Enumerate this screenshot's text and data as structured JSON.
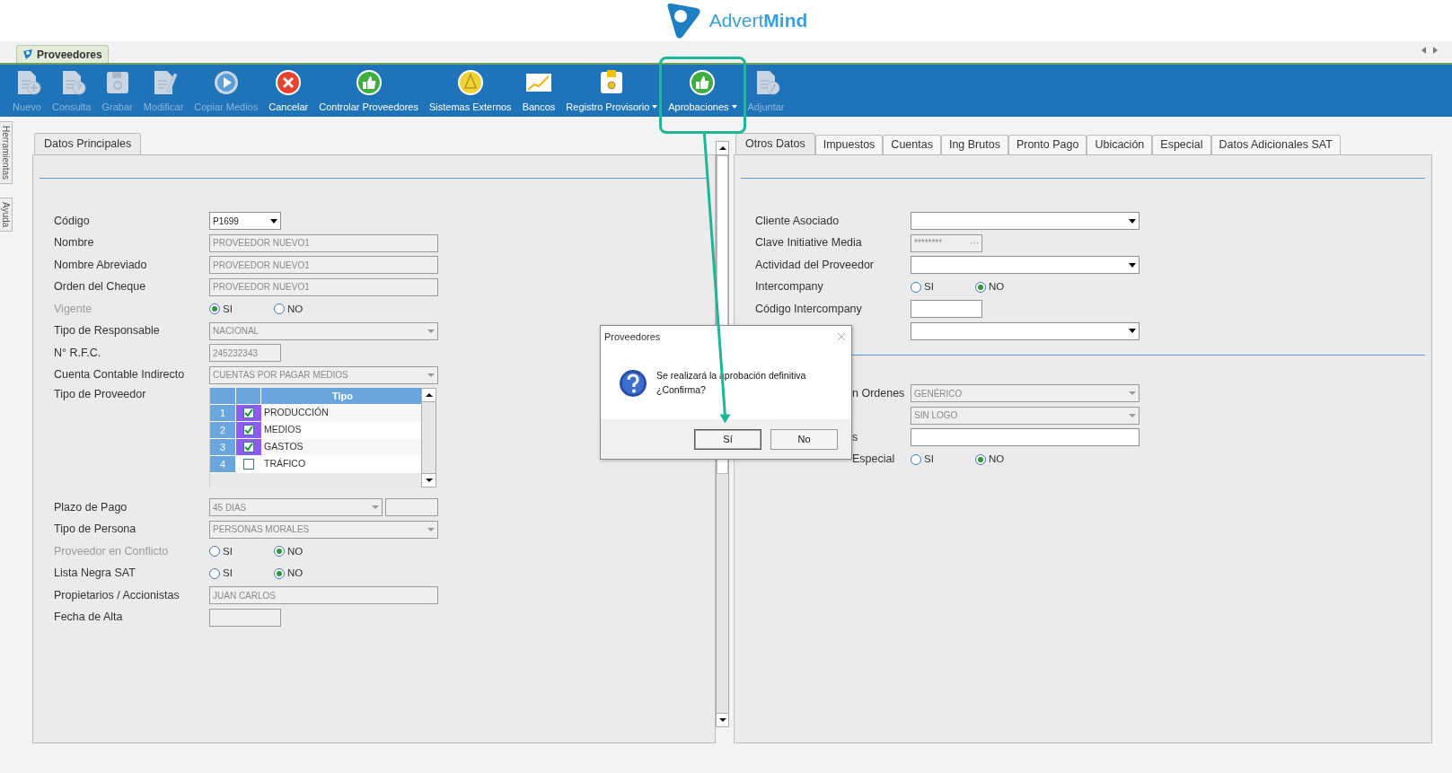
{
  "app_header": {
    "logo": "Advert**Mind**"
  },
  "document_tabs": [
    {
      "label": "Proveedores",
      "selected": true
    }
  ],
  "toolbar": [
    {
      "label": "Nuevo",
      "disabled": true,
      "dropdown": false,
      "highlighted": false
    },
    {
      "label": "Consulta",
      "disabled": true,
      "dropdown": false,
      "highlighted": false
    },
    {
      "label": "Grabar",
      "disabled": true,
      "dropdown": false,
      "highlighted": false
    },
    {
      "label": "Modificar",
      "disabled": true,
      "dropdown": false,
      "highlighted": false
    },
    {
      "label": "Copiar Medios",
      "disabled": true,
      "dropdown": false,
      "highlighted": false
    },
    {
      "label": "Cancelar",
      "disabled": false,
      "dropdown": false,
      "highlighted": false
    },
    {
      "label": "Controlar Proveedores",
      "disabled": false,
      "dropdown": false,
      "highlighted": false
    },
    {
      "label": "Sistemas Externos",
      "disabled": false,
      "dropdown": false,
      "highlighted": false
    },
    {
      "label": "Bancos",
      "disabled": false,
      "dropdown": false,
      "highlighted": false
    },
    {
      "label": "Registro Provisorio",
      "disabled": false,
      "dropdown": true,
      "highlighted": false
    },
    {
      "label": "Aprobaciones",
      "disabled": false,
      "dropdown": true,
      "highlighted": true
    },
    {
      "label": "Adjuntar",
      "disabled": true,
      "dropdown": false,
      "highlighted": false
    }
  ],
  "side_tabs": [
    "Herramientas",
    "Ayuda"
  ],
  "left_panel": {
    "tabs": [
      {
        "label": "Datos Principales",
        "selected": true
      }
    ],
    "fields": [
      {
        "kind": "short_select",
        "label": "Código",
        "value": "P1699",
        "disabled": false,
        "dimmed": false
      },
      {
        "kind": "input",
        "label": "Nombre",
        "value": "PROVEEDOR NUEVO1",
        "disabled": true,
        "dimmed": false
      },
      {
        "kind": "input",
        "label": "Nombre Abreviado",
        "value": "PROVEEDOR NUEVO1",
        "disabled": true,
        "dimmed": false
      },
      {
        "kind": "input",
        "label": "Orden del Cheque",
        "value": "PROVEEDOR NUEVO1",
        "disabled": true,
        "dimmed": false
      },
      {
        "kind": "radio",
        "label": "Vigente",
        "dimmed": true,
        "options": [
          {
            "label": "SI",
            "selected": true
          },
          {
            "label": "NO",
            "selected": false
          }
        ]
      },
      {
        "kind": "select",
        "label": "Tipo de Responsable",
        "value": "NACIONAL",
        "disabled": true,
        "dimmed": false
      },
      {
        "kind": "short_input",
        "label": "N° R.F.C.",
        "value": "245232343",
        "disabled": true,
        "dimmed": false
      },
      {
        "kind": "select",
        "label": "Cuenta Contable Indirecto",
        "value": "CUENTAS POR PAGAR MEDIOS",
        "disabled": true,
        "dimmed": false
      },
      {
        "kind": "grid",
        "label": "Tipo de Proveedor",
        "dimmed": false,
        "columns": [
          "Tipo"
        ],
        "rows": [
          {
            "number": "1",
            "checked": true,
            "name": "PRODUCCIÓN"
          },
          {
            "number": "2",
            "checked": true,
            "name": "MEDIOS"
          },
          {
            "number": "3",
            "checked": true,
            "name": "GASTOS"
          },
          {
            "number": "4",
            "checked": false,
            "name": "TRÁFICO"
          }
        ]
      },
      {
        "kind": "select",
        "label": "Plazo de Pago",
        "value": "45 DIAS",
        "disabled": true,
        "dimmed": false,
        "extra_field": true
      },
      {
        "kind": "select",
        "label": "Tipo de Persona",
        "value": "PERSONAS MORALES",
        "disabled": true,
        "dimmed": false
      },
      {
        "kind": "radio",
        "label": "Proveedor en Conflicto",
        "dimmed": true,
        "options": [
          {
            "label": "SI",
            "selected": false
          },
          {
            "label": "NO",
            "selected": true
          }
        ]
      },
      {
        "kind": "radio",
        "label": "Lista Negra SAT",
        "dimmed": false,
        "options": [
          {
            "label": "SI",
            "selected": false
          },
          {
            "label": "NO",
            "selected": true
          }
        ]
      },
      {
        "kind": "input",
        "label": "Propietarios / Accionistas",
        "value": "JUAN CARLOS",
        "disabled": true,
        "dimmed": false
      },
      {
        "kind": "short_input",
        "label": "Fecha de Alta",
        "disabled": true,
        "dimmed": false
      }
    ]
  },
  "right_panel": {
    "tabs": [
      {
        "label": "Otros Datos",
        "selected": true
      },
      {
        "label": "Impuestos",
        "selected": false
      },
      {
        "label": "Cuentas",
        "selected": false
      },
      {
        "label": "Ing Brutos",
        "selected": false
      },
      {
        "label": "Pronto Pago",
        "selected": false
      },
      {
        "label": "Ubicación",
        "selected": false
      },
      {
        "label": "Especial",
        "selected": false
      },
      {
        "label": "Datos Adicionales SAT",
        "selected": false
      }
    ],
    "sections": [
      [
        {
          "kind": "select",
          "label": "Cliente Asociado",
          "disabled": false,
          "dimmed": false
        },
        {
          "kind": "masked",
          "label": "Clave Initiative Media",
          "value": "********",
          "button": "···",
          "disabled": true,
          "dimmed": false
        },
        {
          "kind": "select",
          "label": "Actividad del Proveedor",
          "disabled": false,
          "dimmed": false
        },
        {
          "kind": "radio",
          "label": "Intercompany",
          "dimmed": false,
          "options": [
            {
              "label": "SI",
              "selected": false
            },
            {
              "label": "NO",
              "selected": true
            }
          ]
        },
        {
          "kind": "short_input",
          "label": "Código Intercompany",
          "disabled": false,
          "dimmed": false
        },
        {
          "kind": "select",
          "disabled": false
        }
      ],
      [
        {
          "kind": "select",
          "label": "n Ordenes",
          "value": "GENÉRICO",
          "disabled": true,
          "dimmed": false
        },
        {
          "kind": "select",
          "value": "SIN LOGO",
          "disabled": true
        },
        {
          "kind": "input",
          "label": "s",
          "disabled": false,
          "dimmed": false
        },
        {
          "kind": "radio",
          "label": "Especial",
          "dimmed": false,
          "options": [
            {
              "label": "SI",
              "selected": false
            },
            {
              "label": "NO",
              "selected": true
            }
          ]
        }
      ]
    ]
  },
  "dialog": {
    "title": "Proveedores",
    "message": [
      "Se realizará la aprobación definitiva",
      "¿Confirma?"
    ],
    "buttons": [
      {
        "label": "Sí",
        "default": true
      },
      {
        "label": "No",
        "default": false
      }
    ]
  }
}
